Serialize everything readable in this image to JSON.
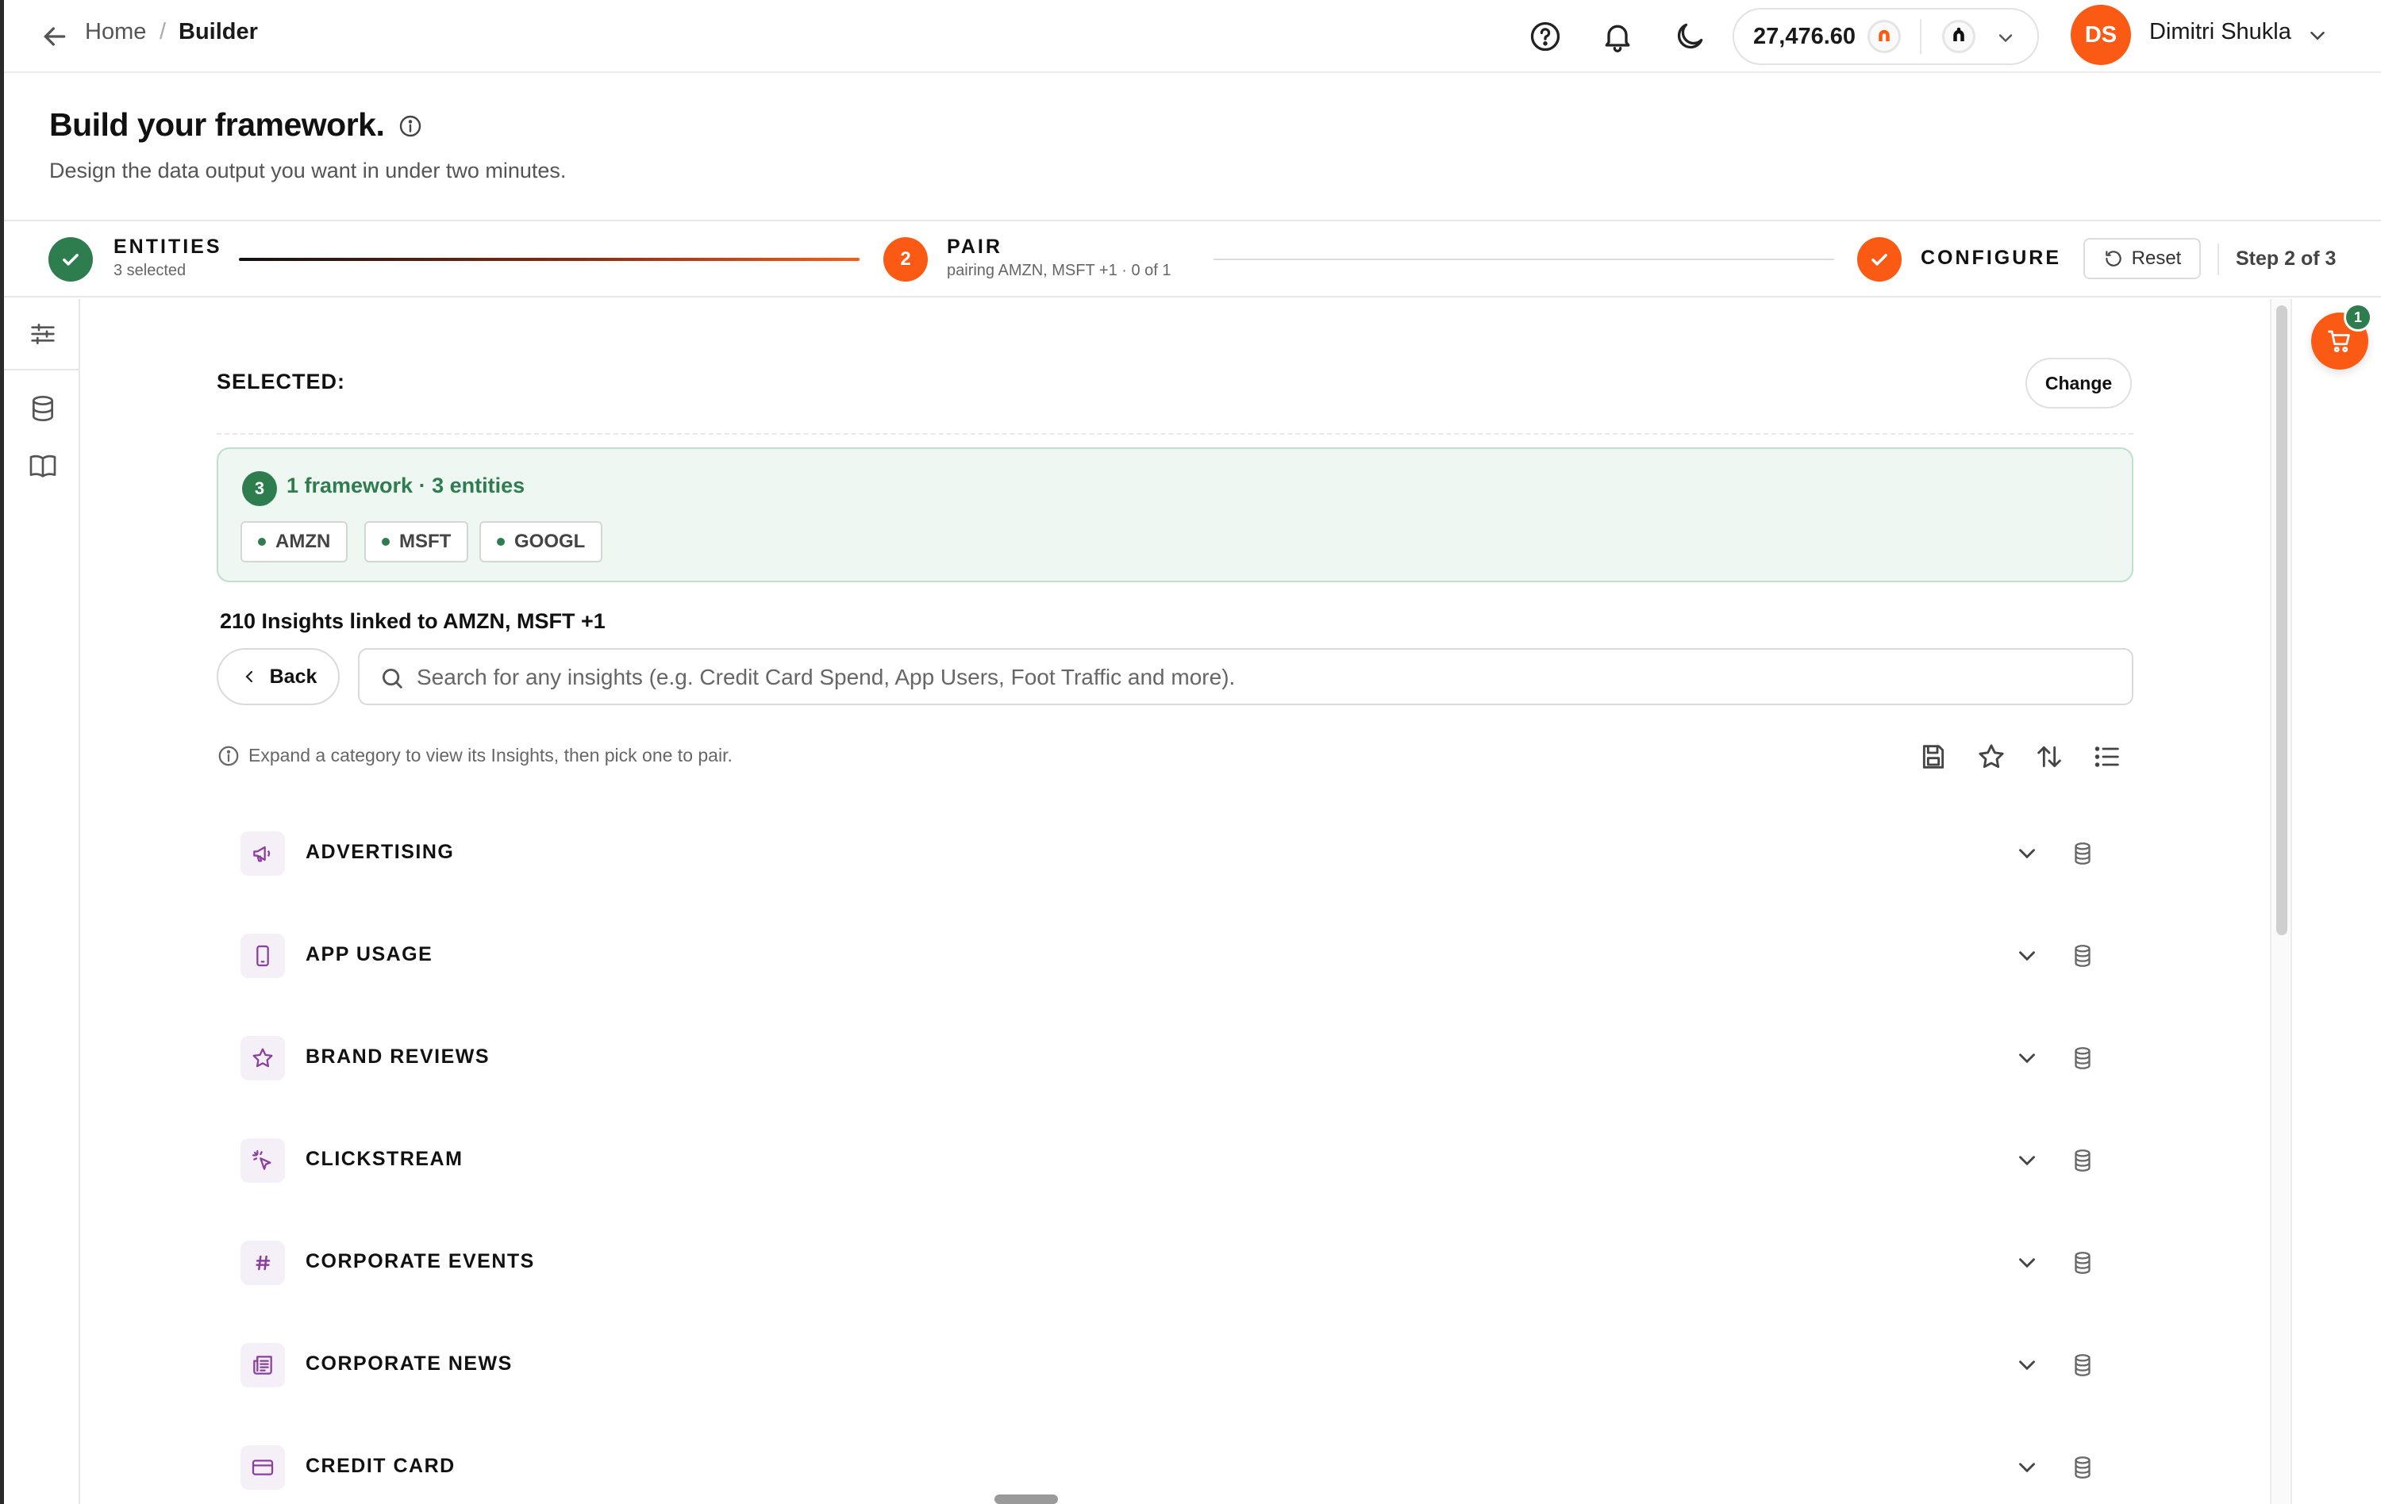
{
  "breadcrumb": {
    "home": "Home",
    "separator": "/",
    "current": "Builder"
  },
  "credits": {
    "value": "27,476.60"
  },
  "user": {
    "initials": "DS",
    "name": "Dimitri Shukla"
  },
  "page": {
    "title": "Build your framework.",
    "subtitle": "Design the data output you want in under two minutes."
  },
  "stepper": {
    "steps": [
      {
        "title": "ENTITIES",
        "subtitle": "3 selected",
        "state": "done"
      },
      {
        "title": "PAIR",
        "subtitle": "pairing AMZN, MSFT +1 · 0 of 1",
        "number": "2",
        "state": "active"
      },
      {
        "title": "CONFIGURE",
        "subtitle": "",
        "state": "done"
      }
    ],
    "reset_label": "Reset",
    "step_count": "Step 2 of 3"
  },
  "selected": {
    "label": "SELECTED:",
    "change_label": "Change",
    "count": "3",
    "summary": "1 framework · 3 entities",
    "entities": [
      "AMZN",
      "MSFT",
      "GOOGL"
    ]
  },
  "insights": {
    "title": "210 Insights linked to AMZN, MSFT +1",
    "back_label": "Back",
    "search_placeholder": "Search for any insights (e.g. Credit Card Spend, App Users, Foot Traffic and more).",
    "hint": "Expand a category to view its Insights, then pick one to pair."
  },
  "categories": [
    {
      "label": "ADVERTISING",
      "icon": "megaphone-icon"
    },
    {
      "label": "APP USAGE",
      "icon": "phone-icon"
    },
    {
      "label": "BRAND REVIEWS",
      "icon": "star-icon"
    },
    {
      "label": "CLICKSTREAM",
      "icon": "cursor-click-icon"
    },
    {
      "label": "CORPORATE EVENTS",
      "icon": "hash-icon"
    },
    {
      "label": "CORPORATE NEWS",
      "icon": "newspaper-icon"
    },
    {
      "label": "CREDIT CARD",
      "icon": "credit-card-icon"
    }
  ],
  "cart": {
    "count": "1"
  },
  "colors": {
    "accent": "#fb5a14",
    "success": "#2e7d4f",
    "category_icon": "#8a3fa0"
  }
}
